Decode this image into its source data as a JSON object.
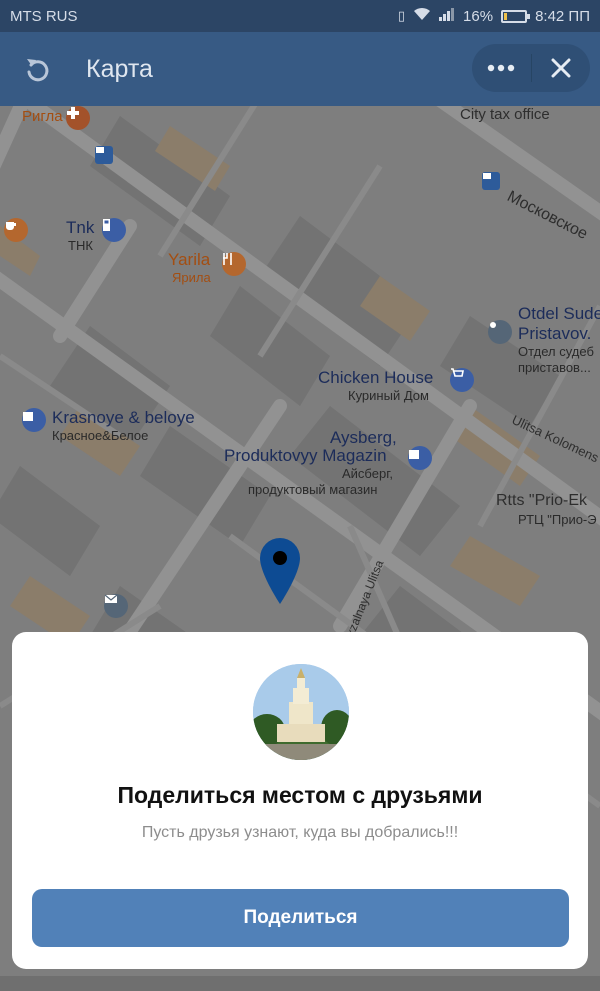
{
  "status_bar": {
    "carrier": "MTS RUS",
    "battery": "16%",
    "battery_level": 0.16,
    "time": "8:42 ПП"
  },
  "header": {
    "title": "Карта",
    "back_icon": "refresh-back-icon",
    "more_icon": "more-dots-icon",
    "close_icon": "close-icon"
  },
  "map": {
    "labels": {
      "rigla": "Ригла",
      "city_tax": "City tax office",
      "moskovskoe": "Московское",
      "tnk_en": "Tnk",
      "tnk_ru": "ТНК",
      "yarila_en": "Yarila",
      "yarila_ru": "Ярила",
      "otdel_1": "Otdel Sude",
      "otdel_2": "Pristavov.",
      "otdel_3": "Отдел судеб",
      "otdel_4": "приставов...",
      "chicken_en": "Chicken House",
      "chicken_ru": "Куриный Дом",
      "krasnoye_en": "Krasnoye & beloye",
      "krasnoye_ru": "Красное&Белое",
      "ulitsa_kolomens": "Ulitsa Kolomens",
      "aysberg_1": "Aysberg,",
      "aysberg_2": "Produktovyy Magazin",
      "aysberg_3": "Айсберг,",
      "aysberg_4": "продуктовый магазин",
      "rtts_en": "Rtts \"Prio-Ek",
      "rtts_ru": "РТЦ \"Прио-Э",
      "street_vertical": "Vokzalnaya Ulitsa"
    },
    "colors": {
      "background": "#7e7e7e",
      "road": "#8f8f8f",
      "building": "#777777",
      "orange_block": "#8b7d6a",
      "pin": "#0d4b93"
    }
  },
  "share_card": {
    "title": "Поделиться местом с друзьями",
    "subtitle": "Пусть друзья узнают, куда вы добрались!!!",
    "button_label": "Поделиться",
    "button_color": "#5181b8"
  }
}
